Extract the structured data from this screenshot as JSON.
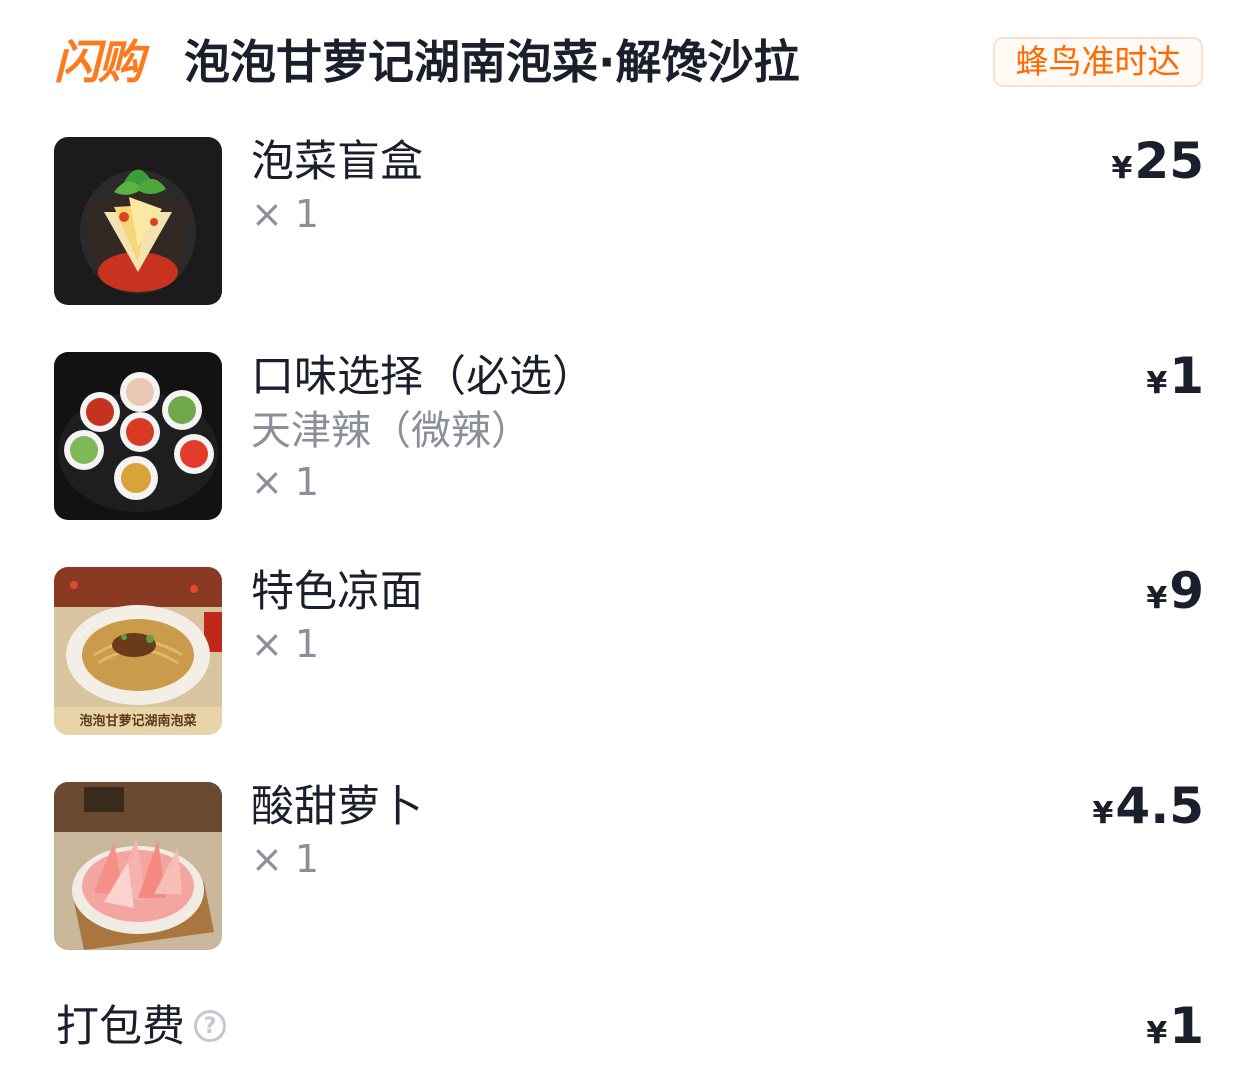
{
  "header": {
    "brand": "闪购",
    "store_name": "泡泡甘萝记湖南泡菜·解馋沙拉",
    "delivery_badge": "蜂鸟准时达"
  },
  "currency": "¥",
  "items": [
    {
      "name": "泡菜盲盒",
      "spec": "",
      "qty": "× 1",
      "price": "25",
      "image": "pickled-vegetable-bowl"
    },
    {
      "name": "口味选择（必选）",
      "spec": "天津辣（微辣）",
      "qty": "× 1",
      "price": "1",
      "image": "sauce-cups-platter"
    },
    {
      "name": "特色凉面",
      "spec": "",
      "qty": "× 1",
      "price": "9",
      "image": "cold-noodles-plate",
      "image_caption": "泡泡甘萝记湖南泡菜"
    },
    {
      "name": "酸甜萝卜",
      "spec": "",
      "qty": "× 1",
      "price": "4.5",
      "image": "radish-slices-bowl"
    }
  ],
  "packing_fee": {
    "label": "打包费",
    "help_icon": "question-circle-icon",
    "price": "1"
  },
  "colors": {
    "brand_orange": "#ff7a1f",
    "badge_text": "#ff6a00",
    "primary_text": "#1a1f2b",
    "secondary_text": "#8a8f99"
  }
}
